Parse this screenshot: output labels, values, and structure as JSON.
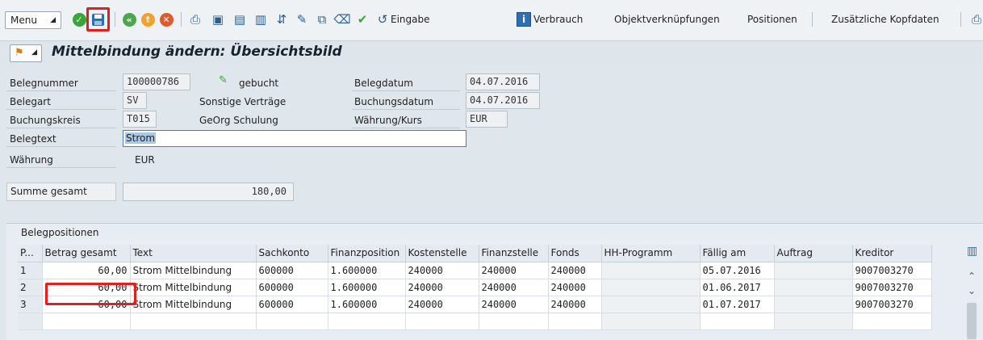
{
  "toolbar": {
    "menu_label": "Menu",
    "eingabe_label": "Eingabe",
    "verbrauch_label": "Verbrauch",
    "objekt_label": "Objektverknüpfungen",
    "positionen_label": "Positionen",
    "kopfdaten_label": "Zusätzliche Kopfdaten",
    "icons": [
      "check-icon",
      "save-icon",
      "back-icon",
      "exit-icon",
      "cancel-icon",
      "print-icon",
      "find-icon",
      "find-next-icon",
      "first-page-icon",
      "next-page-icon",
      "last-page-icon",
      "edit-icon",
      "copy-icon",
      "delete-icon",
      "check-doc-icon",
      "refresh-icon",
      "info-icon"
    ]
  },
  "title": "Mittelbindung ändern: Übersichtsbild",
  "header": {
    "belegnummer_label": "Belegnummer",
    "belegnummer": "100000786",
    "status": "gebucht",
    "belegart_label": "Belegart",
    "belegart": "SV",
    "belegart_text": "Sonstige Verträge",
    "buchungskreis_label": "Buchungskreis",
    "buchungskreis": "T015",
    "buchungskreis_text": "GeOrg Schulung",
    "belegdatum_label": "Belegdatum",
    "belegdatum": "04.07.2016",
    "buchungsdatum_label": "Buchungsdatum",
    "buchungsdatum": "04.07.2016",
    "waehrung_kurs_label": "Währung/Kurs",
    "waehrung_kurs": "EUR",
    "belegtext_label": "Belegtext",
    "belegtext": "Strom",
    "waehrung_label": "Währung",
    "waehrung": "EUR",
    "summe_label": "Summe gesamt",
    "summe": "180,00"
  },
  "table": {
    "title": "Belegpositionen",
    "columns": [
      "P...",
      "Betrag gesamt",
      "Text",
      "Sachkonto",
      "Finanzposition",
      "Kostenstelle",
      "Finanzstelle",
      "Fonds",
      "HH-Programm",
      "Fällig am",
      "Auftrag",
      "Kreditor"
    ],
    "rows": [
      [
        "1",
        "60,00",
        "Strom Mittelbindung",
        "600000",
        "1.600000",
        "240000",
        "240000",
        "240000",
        "",
        "05.07.2016",
        "",
        "9007003270"
      ],
      [
        "2",
        "60,00",
        "Strom Mittelbindung",
        "600000",
        "1.600000",
        "240000",
        "240000",
        "240000",
        "",
        "01.06.2017",
        "",
        "9007003270"
      ],
      [
        "3",
        "60,00",
        "Strom Mittelbindung",
        "600000",
        "1.600000",
        "240000",
        "240000",
        "240000",
        "",
        "01.07.2017",
        "",
        "9007003270"
      ]
    ]
  },
  "colors": {
    "highlight": "#e02020",
    "accent": "#2c6fb3"
  }
}
